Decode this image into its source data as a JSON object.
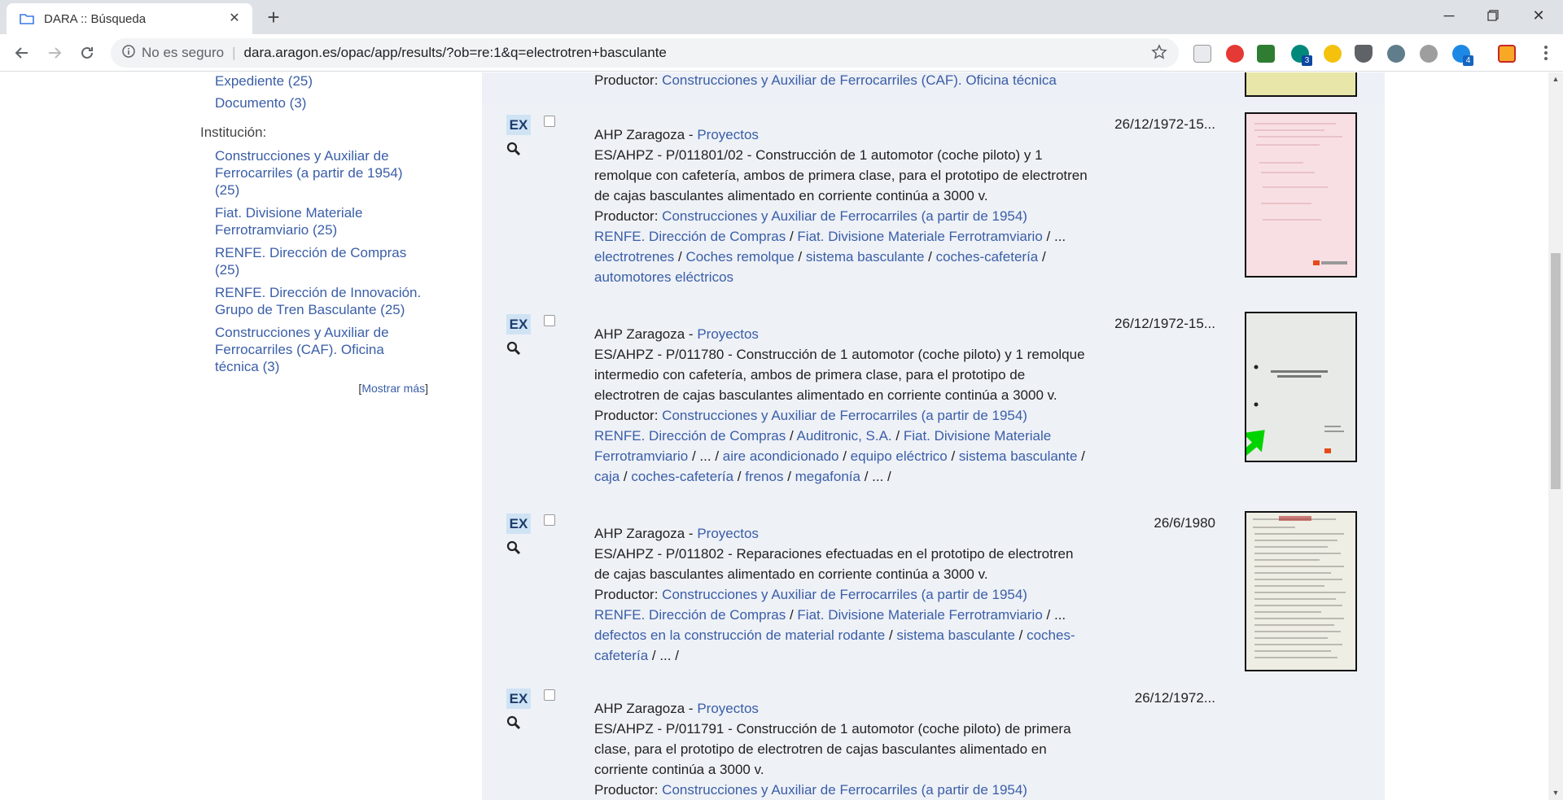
{
  "browser": {
    "tab_title": "DARA :: Búsqueda",
    "security_label": "No es seguro",
    "url": "dara.aragon.es/opac/app/results/?ob=re:1&q=electrotren+basculante",
    "ext_badge_1": "3",
    "ext_badge_2": "4"
  },
  "sidebar": {
    "type_items": [
      {
        "label": "Expediente (25)"
      },
      {
        "label": "Documento (3)"
      }
    ],
    "institution_title": "Institución:",
    "institution_items": [
      {
        "label": "Construcciones y Auxiliar de Ferrocarriles (a partir de 1954) (25)"
      },
      {
        "label": "Fiat. Divisione Materiale Ferrotramviario (25)"
      },
      {
        "label": "RENFE. Dirección de Compras (25)"
      },
      {
        "label": "RENFE. Dirección de Innovación. Grupo de Tren Basculante (25)"
      },
      {
        "label": "Construcciones y Auxiliar de Ferrocarriles (CAF). Oficina técnica (3)"
      }
    ],
    "more_open": "[",
    "more_label": "Mostrar más",
    "more_close": "]"
  },
  "results": {
    "top_fragment": {
      "producer_label": "Productor:",
      "producer": "Construcciones y Auxiliar de Ferrocarriles (CAF). Oficina técnica"
    },
    "items": [
      {
        "badge": "EX",
        "archive": "AHP Zaragoza",
        "section": "Proyectos",
        "code": "ES/AHPZ - P/011801/02",
        "description": "Construcción de 1 automotor (coche piloto) y 1 remolque con cafetería, ambos de primera clase, para el prototipo de electrotren de cajas basculantes alimentado en corriente continúa a 3000 v.",
        "producer_label": "Productor:",
        "producer": "Construcciones y Auxiliar de Ferrocarriles (a partir de 1954)",
        "date": "26/12/1972-15...",
        "links_1": [
          "RENFE. Dirección de Compras",
          "Fiat. Divisione Materiale Ferrotramviario"
        ],
        "links_2": [
          "electrotrenes",
          "Coches remolque",
          "sistema basculante",
          "coches-cafetería",
          "automotores eléctricos"
        ]
      },
      {
        "badge": "EX",
        "archive": "AHP Zaragoza",
        "section": "Proyectos",
        "code": "ES/AHPZ - P/011780",
        "description": "Construcción de 1 automotor (coche piloto) y 1 remolque intermedio con cafetería, ambos de primera clase, para el prototipo de electrotren de cajas basculantes alimentado en corriente continúa a 3000 v.",
        "producer_label": "Productor:",
        "producer": "Construcciones y Auxiliar de Ferrocarriles (a partir de 1954)",
        "date": "26/12/1972-15...",
        "links_1": [
          "RENFE. Dirección de Compras",
          "Auditronic, S.A.",
          "Fiat. Divisione Materiale Ferrotramviario"
        ],
        "links_2": [
          "aire acondicionado",
          "equipo eléctrico",
          "sistema basculante",
          "caja",
          "coches-cafetería",
          "frenos",
          "megafonía"
        ]
      },
      {
        "badge": "EX",
        "archive": "AHP Zaragoza",
        "section": "Proyectos",
        "code": "ES/AHPZ - P/011802",
        "description": "Reparaciones efectuadas en el prototipo de electrotren de cajas basculantes alimentado en corriente continúa a 3000 v.",
        "producer_label": "Productor:",
        "producer": "Construcciones y Auxiliar de Ferrocarriles (a partir de 1954)",
        "date": "26/6/1980",
        "links_1": [
          "RENFE. Dirección de Compras",
          "Fiat. Divisione Materiale Ferrotramviario"
        ],
        "links_2": [
          "defectos en la construcción de material rodante",
          "sistema basculante",
          "coches-cafetería"
        ]
      },
      {
        "badge": "EX",
        "archive": "AHP Zaragoza",
        "section": "Proyectos",
        "code": "ES/AHPZ - P/011791",
        "description": "Construcción de 1 automotor (coche piloto) de primera clase, para el prototipo de electrotren de cajas basculantes alimentado en corriente continúa a 3000 v.",
        "producer_label": "Productor:",
        "producer": "Construcciones y Auxiliar de Ferrocarriles (a partir de 1954)",
        "date": "26/12/1972..."
      }
    ],
    "separator": " / ",
    "ellipsis": "...",
    "dash": " - "
  }
}
